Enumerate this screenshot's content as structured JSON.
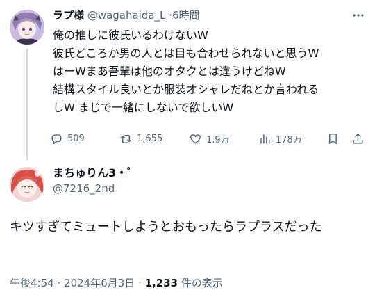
{
  "parent_tweet": {
    "display_name": "ラプ様",
    "handle": "@wagahaida_L",
    "separator": "·",
    "time": "6時間",
    "text_lines": [
      "俺の推しに彼氏いるわけないW",
      "彼氏どころか男の人とは目も合わせられないと思うW",
      "はーWまあ吾輩は他のオタクとは違うけどねW",
      "結構スタイル良いとか服装オシャレだねとか言われる",
      "しW まじで一緒にしないで欲しいW"
    ],
    "stats": {
      "replies": "509",
      "retweets": "1,655",
      "likes": "1.9万",
      "views": "178万"
    }
  },
  "reply_tweet": {
    "display_name": "まちゅりん3・ﾟ",
    "handle": "@7216_2nd",
    "text": "キツすぎてミュートしようとおもったらラプラスだった",
    "meta": {
      "time": "午後4:54",
      "dot1": "·",
      "date": "2024年6月3日",
      "dot2": "·",
      "views_count": "1,233",
      "views_label": "件の表示"
    }
  },
  "icons": {
    "more": "more-icon",
    "reply": "reply-icon",
    "retweet": "retweet-icon",
    "like": "heart-icon",
    "views": "views-icon",
    "bookmark": "bookmark-icon",
    "share": "share-icon"
  },
  "colors": {
    "text": "#0f1419",
    "muted": "#536471",
    "thread_line": "#cfd9de"
  }
}
